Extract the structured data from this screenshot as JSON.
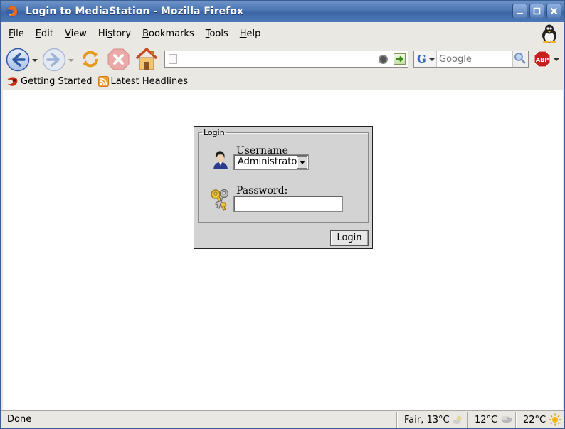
{
  "window": {
    "title": "Login to MediaStation - Mozilla Firefox"
  },
  "menu": {
    "items": [
      {
        "label": "File",
        "underline": "F",
        "rest": "ile"
      },
      {
        "label": "Edit",
        "underline": "E",
        "rest": "dit"
      },
      {
        "label": "View",
        "underline": "V",
        "rest": "iew"
      },
      {
        "label": "History",
        "underline": "s",
        "pre": "Hi",
        "rest": "tory"
      },
      {
        "label": "Bookmarks",
        "underline": "B",
        "rest": "ookmarks"
      },
      {
        "label": "Tools",
        "underline": "T",
        "rest": "ools"
      },
      {
        "label": "Help",
        "underline": "H",
        "rest": "elp"
      }
    ]
  },
  "toolbar": {
    "url_value": "",
    "search_placeholder": "Google",
    "search_engine_letter": "G"
  },
  "bookmarks": {
    "items": [
      {
        "label": "Getting Started",
        "icon": "firefox-icon"
      },
      {
        "label": "Latest Headlines",
        "icon": "rss-feed-icon"
      }
    ]
  },
  "login_form": {
    "legend": "Login",
    "username_label": "Username",
    "username_selected": "Administrator",
    "password_label": "Password:",
    "password_value": "",
    "submit_label": "Login"
  },
  "statusbar": {
    "status": "Done",
    "weather_now": "Fair, 13°C",
    "forecast_1": "12°C",
    "forecast_2": "22°C"
  },
  "colors": {
    "titlebar": "#4a74b2",
    "login_panel": "#d3d3d3",
    "content_bg": "#ffffff"
  }
}
